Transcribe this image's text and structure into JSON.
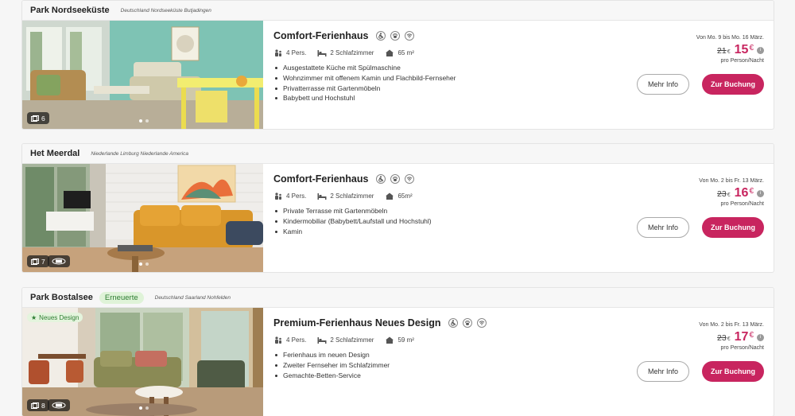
{
  "listings": [
    {
      "park": "Park Nordseeküste",
      "badge": "",
      "location": "Deutschland Nordseeküste Butjadingen",
      "photo_badge": "",
      "photo_count": "6",
      "house_type": "Comfort-Ferienhaus",
      "amenity_icons": [
        "wheelchair-icon",
        "pet-icon",
        "wifi-icon"
      ],
      "persons": "4 Pers.",
      "bedrooms": "2 Schlafzimmer",
      "area": "65 m²",
      "features": [
        "Ausgestattete Küche mit Spülmaschine",
        "Wohnzimmer mit offenem Kamin und Flachbild-Fernseher",
        "Privatterrasse mit Gartenmöbeln",
        "Babybett und Hochstuhl"
      ],
      "date_range": "Von Mo. 9 bis Mo. 16 März.",
      "old_price": "21",
      "new_price": "15",
      "currency": "€",
      "per_person": "pro Person/Nacht",
      "more_info_label": "Mehr Info",
      "book_label": "Zur Buchung"
    },
    {
      "park": "Het Meerdal",
      "badge": "",
      "location": "Niederlande Limburg Niederlande America",
      "photo_badge": "",
      "photo_count": "7",
      "house_type": "Comfort-Ferienhaus",
      "amenity_icons": [
        "wheelchair-icon",
        "pet-icon",
        "wifi-icon"
      ],
      "persons": "4 Pers.",
      "bedrooms": "2 Schlafzimmer",
      "area": "65m²",
      "features": [
        "Private Terrasse mit Gartenmöbeln",
        "Kindermobiliar (Babybett/Laufstall und Hochstuhl)",
        "Kamin"
      ],
      "date_range": "Von Mo. 2 bis Fr. 13 März.",
      "old_price": "23",
      "new_price": "16",
      "currency": "€",
      "per_person": "pro Person/Nacht",
      "more_info_label": "Mehr Info",
      "book_label": "Zur Buchung"
    },
    {
      "park": "Park Bostalsee",
      "badge": "Erneuerte",
      "location": "Deutschland Saarland Nohfelden",
      "photo_badge": "Neues Design",
      "photo_count": "8",
      "house_type": "Premium-Ferienhaus Neues Design",
      "amenity_icons": [
        "wheelchair-icon",
        "pet-icon",
        "wifi-icon"
      ],
      "persons": "4 Pers.",
      "bedrooms": "2 Schlafzimmer",
      "area": "59 m²",
      "features": [
        "Ferienhaus im neuen Design",
        "Zweiter Fernseher im Schlafzimmer",
        "Gemachte-Betten-Service"
      ],
      "date_range": "Von Mo. 2 bis Fr. 13 März.",
      "old_price": "23",
      "new_price": "17",
      "currency": "€",
      "per_person": "pro Person/Nacht",
      "more_info_label": "Mehr Info",
      "book_label": "Zur Buchung"
    }
  ],
  "colors": {
    "accent": "#c8255f",
    "badge_green": "#2e7d32",
    "badge_bg": "#dff3d8"
  }
}
